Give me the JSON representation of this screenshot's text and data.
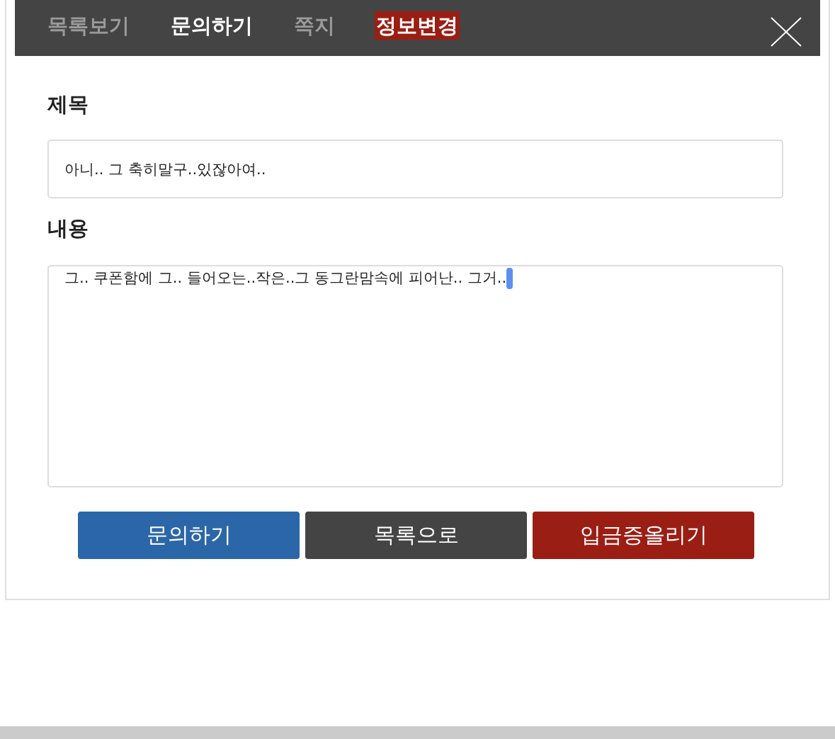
{
  "tabs": [
    {
      "label": "목록보기",
      "selected": false,
      "highlighted": false
    },
    {
      "label": "문의하기",
      "selected": true,
      "highlighted": false
    },
    {
      "label": "쪽지",
      "selected": false,
      "highlighted": false
    },
    {
      "label": "정보변경",
      "selected": false,
      "highlighted": true
    }
  ],
  "form": {
    "title_label": "제목",
    "title_value": "아니.. 그 축히말구..있잖아여..",
    "content_label": "내용",
    "content_value": "그.. 쿠폰함에 그.. 들어오는..작은..그 동그란맘속에 피어난.. 그거.."
  },
  "buttons": [
    {
      "label": "문의하기",
      "color": "#2b67a8"
    },
    {
      "label": "목록으로",
      "color": "#444444"
    },
    {
      "label": "입금증올리기",
      "color": "#9b1e14"
    }
  ]
}
